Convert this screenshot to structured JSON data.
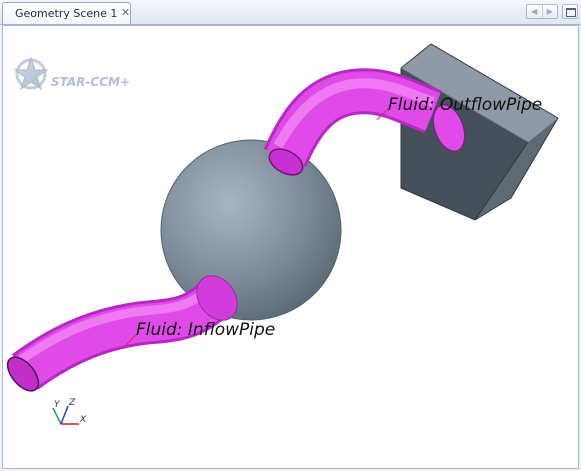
{
  "tab": {
    "title": "Geometry Scene 1",
    "close_glyph": "✕"
  },
  "nav": {
    "prev_glyph": "◀",
    "next_glyph": "▶"
  },
  "logo": {
    "text": "STAR-CCM+"
  },
  "labels": {
    "outflow": "Fluid: OutflowPipe",
    "inflow": "Fluid: InflowPipe"
  },
  "triad": {
    "x": "X",
    "y": "Y",
    "z": "Z"
  },
  "colors": {
    "pipe": "#e040e8",
    "sphere": "#7c8a98",
    "box": "#4a5560",
    "label_leader": "#e0207a",
    "axis_x": "#d02020",
    "axis_y": "#20a040",
    "axis_z": "#2040c0"
  }
}
